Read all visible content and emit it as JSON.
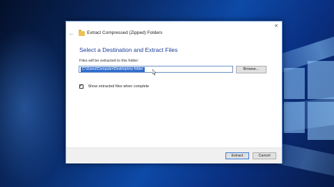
{
  "dialog": {
    "title": "Extract Compressed (Zipped) Folders",
    "heading": "Select a Destination and Extract Files",
    "path_label": "Files will be extracted to this folder:",
    "path_value": "C:\\Users\\Computer\\Desktop\\my folder",
    "browse_label": "Browse...",
    "show_files_label": "Show extracted files when complete",
    "show_files_checked": true,
    "extract_label": "Extract",
    "cancel_label": "Cancel",
    "close_glyph": "×",
    "back_glyph": "←",
    "check_glyph": "✓"
  },
  "colors": {
    "heading": "#1d3f9a",
    "selection": "#2f6ccc",
    "desktop": "#0d4aa8"
  },
  "icons": [
    "back-arrow-icon",
    "folder-zip-icon",
    "close-icon",
    "checkmark-icon",
    "mouse-cursor-icon",
    "windows-logo-icon"
  ]
}
